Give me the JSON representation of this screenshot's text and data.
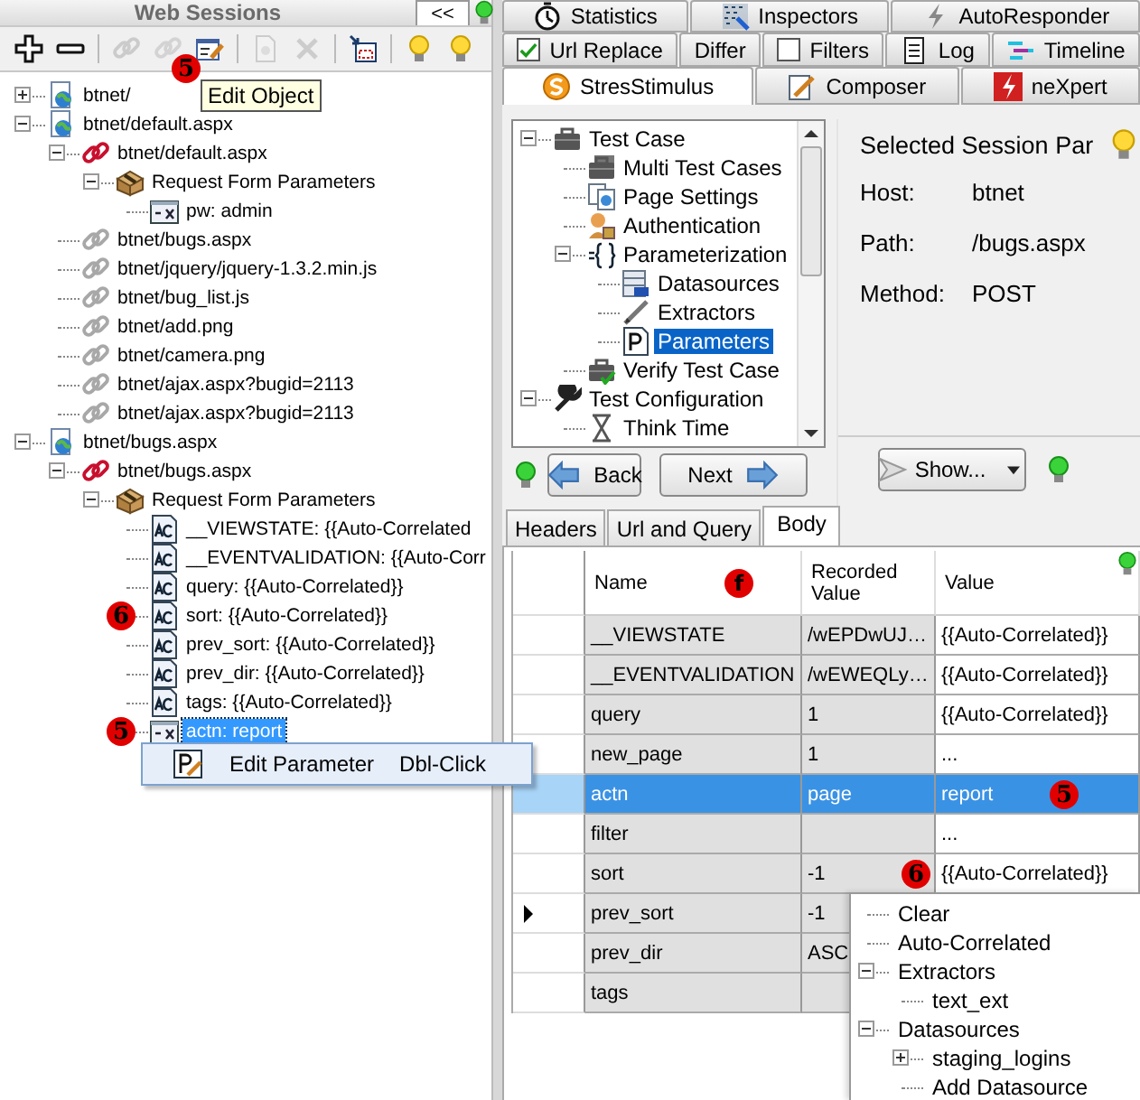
{
  "web_sessions": {
    "title": "Web Sessions",
    "collapse_label": "<<",
    "toolbar": [
      {
        "kind": "add",
        "disabled": false
      },
      {
        "kind": "remove",
        "disabled": false
      },
      {
        "kind": "link",
        "disabled": true
      },
      {
        "kind": "unlink",
        "disabled": true
      },
      {
        "kind": "edit",
        "disabled": false,
        "badge": "5"
      },
      {
        "kind": "page",
        "disabled": true
      },
      {
        "kind": "delete",
        "disabled": true
      },
      {
        "kind": "split",
        "disabled": false
      },
      {
        "kind": "bulb",
        "disabled": false
      },
      {
        "kind": "bulb",
        "disabled": false
      }
    ],
    "tooltip": "Edit Object",
    "tree": [
      {
        "label": "btnet/",
        "kind": "page",
        "expanded": false,
        "selected": false
      },
      {
        "label": "btnet/default.aspx",
        "kind": "page",
        "expanded": true,
        "selected": false,
        "children": [
          {
            "label": "btnet/default.aspx",
            "kind": "request",
            "expanded": true,
            "selected": false,
            "children": [
              {
                "label": "Request Form Parameters",
                "kind": "form",
                "expanded": true,
                "selected": false,
                "children": [
                  {
                    "label": "pw: admin",
                    "kind": "param",
                    "selected": false
                  }
                ]
              }
            ]
          },
          {
            "label": "btnet/bugs.aspx",
            "kind": "link",
            "selected": false
          },
          {
            "label": "btnet/jquery/jquery-1.3.2.min.js",
            "kind": "link",
            "selected": false
          },
          {
            "label": "btnet/bug_list.js",
            "kind": "link",
            "selected": false
          },
          {
            "label": "btnet/add.png",
            "kind": "link",
            "selected": false
          },
          {
            "label": "btnet/camera.png",
            "kind": "link",
            "selected": false
          },
          {
            "label": "btnet/ajax.aspx?bugid=2113",
            "kind": "link",
            "selected": false
          },
          {
            "label": "btnet/ajax.aspx?bugid=2113",
            "kind": "link",
            "selected": false
          }
        ]
      },
      {
        "label": "btnet/bugs.aspx",
        "kind": "page",
        "expanded": true,
        "selected": false,
        "children": [
          {
            "label": "btnet/bugs.aspx",
            "kind": "request",
            "expanded": true,
            "selected": false,
            "children": [
              {
                "label": "Request Form Parameters",
                "kind": "form",
                "expanded": true,
                "selected": false,
                "children": [
                  {
                    "label": "__VIEWSTATE: {{Auto-Correlated",
                    "kind": "ac",
                    "selected": false
                  },
                  {
                    "label": "__EVENTVALIDATION: {{Auto-Corr",
                    "kind": "ac",
                    "selected": false
                  },
                  {
                    "label": "query: {{Auto-Correlated}}",
                    "kind": "ac",
                    "selected": false
                  },
                  {
                    "label": "sort: {{Auto-Correlated}}",
                    "kind": "ac",
                    "selected": false,
                    "badge": "6"
                  },
                  {
                    "label": "prev_sort: {{Auto-Correlated}}",
                    "kind": "ac",
                    "selected": false
                  },
                  {
                    "label": "prev_dir: {{Auto-Correlated}}",
                    "kind": "ac",
                    "selected": false
                  },
                  {
                    "label": "tags: {{Auto-Correlated}}",
                    "kind": "ac",
                    "selected": false
                  },
                  {
                    "label": "actn: report",
                    "kind": "param",
                    "selected": true,
                    "badge": "5"
                  }
                ]
              }
            ]
          }
        ]
      }
    ],
    "context_menu": {
      "label": "Edit Parameter",
      "shortcut": "Dbl-Click"
    }
  },
  "tab_rows": [
    [
      {
        "label": "Statistics",
        "kind": "stopwatch",
        "selected": false
      },
      {
        "label": "Inspectors",
        "kind": "inspect",
        "selected": false
      },
      {
        "label": "AutoResponder",
        "kind": "bolt",
        "selected": false
      }
    ],
    [
      {
        "label": "Url Replace",
        "kind": "checkbox",
        "checked": true,
        "selected": false
      },
      {
        "label": "Differ",
        "kind": "plain",
        "selected": false
      },
      {
        "label": "Filters",
        "kind": "checkbox",
        "checked": false,
        "selected": false
      },
      {
        "label": "Log",
        "kind": "log",
        "selected": false
      },
      {
        "label": "Timeline",
        "kind": "timeline",
        "selected": false
      }
    ],
    [
      {
        "label": "StresStimulus",
        "kind": "stres",
        "selected": true
      },
      {
        "label": "Composer",
        "kind": "composer",
        "selected": false
      },
      {
        "label": "neXpert",
        "kind": "nexpert",
        "selected": false
      }
    ]
  ],
  "stresstimulus": {
    "wizard_tree": [
      {
        "label": "Test Case",
        "kind": "briefcase",
        "expanded": true,
        "selected": false,
        "children": [
          {
            "label": "Multi Test Cases",
            "kind": "briefcases",
            "selected": false
          },
          {
            "label": "Page Settings",
            "kind": "pages",
            "selected": false
          },
          {
            "label": "Authentication",
            "kind": "person",
            "selected": false
          },
          {
            "label": "Parameterization",
            "kind": "braces",
            "expanded": true,
            "selected": false,
            "children": [
              {
                "label": "Datasources",
                "kind": "datasource",
                "selected": false
              },
              {
                "label": "Extractors",
                "kind": "pen",
                "selected": false
              },
              {
                "label": "Parameters",
                "kind": "pdoc",
                "selected": true
              }
            ]
          },
          {
            "label": "Verify Test Case",
            "kind": "briefcase_check",
            "selected": false
          }
        ]
      },
      {
        "label": "Test Configuration",
        "kind": "wrench",
        "expanded": true,
        "selected": false,
        "children": [
          {
            "label": "Think Time",
            "kind": "hourglass",
            "selected": false
          }
        ]
      }
    ],
    "back": "Back",
    "next": "Next",
    "session_title": "Selected Session Par",
    "fields": [
      {
        "label": "Host:",
        "value": "btnet"
      },
      {
        "label": "Path:",
        "value": "/bugs.aspx"
      },
      {
        "label": "Method:",
        "value": "POST"
      }
    ],
    "show_button": "Show..."
  },
  "body_tabs": [
    {
      "label": "Headers",
      "selected": false
    },
    {
      "label": "Url and Query",
      "selected": false
    },
    {
      "label": "Body",
      "selected": true
    }
  ],
  "grid": {
    "columns": [
      {
        "label": "Name",
        "badge": "f"
      },
      {
        "label": "Recorded Value"
      },
      {
        "label": "Value"
      }
    ],
    "rows": [
      {
        "name": "__VIEWSTATE",
        "recorded": "/wEPDwUJ…",
        "value": "{{Auto-Correlated}}",
        "selected": false,
        "current": false
      },
      {
        "name": "__EVENTVALIDATION",
        "recorded": "/wEWEQLy…",
        "value": "{{Auto-Correlated}}",
        "selected": false,
        "current": false
      },
      {
        "name": "query",
        "recorded": "1",
        "value": "{{Auto-Correlated}}",
        "selected": false,
        "current": false
      },
      {
        "name": "new_page",
        "recorded": "1",
        "value": "...",
        "selected": false,
        "current": false
      },
      {
        "name": "actn",
        "recorded": "page",
        "value": "report",
        "selected": true,
        "current": false,
        "badge": "5"
      },
      {
        "name": "filter",
        "value": "...",
        "selected": false,
        "current": false
      },
      {
        "name": "sort",
        "recorded": "-1",
        "value": "{{Auto-Correlated}}",
        "selected": false,
        "current": false,
        "recorded_badge": "6"
      },
      {
        "name": "prev_sort",
        "recorded": "-1",
        "selected": false,
        "current": true
      },
      {
        "name": "prev_dir",
        "recorded": "ASC",
        "selected": false,
        "current": false
      },
      {
        "name": "tags",
        "selected": false,
        "current": false
      }
    ]
  },
  "value_dropdown": [
    {
      "label": "Clear",
      "selected": false
    },
    {
      "label": "Auto-Correlated",
      "selected": false
    },
    {
      "label": "Extractors",
      "expanded": true,
      "selected": false,
      "children": [
        {
          "label": "text_ext",
          "selected": false
        }
      ]
    },
    {
      "label": "Datasources",
      "expanded": true,
      "selected": false,
      "children": [
        {
          "label": "staging_logins",
          "expanded": false,
          "selected": false
        },
        {
          "label": "Add Datasource",
          "selected": false
        }
      ]
    }
  ]
}
